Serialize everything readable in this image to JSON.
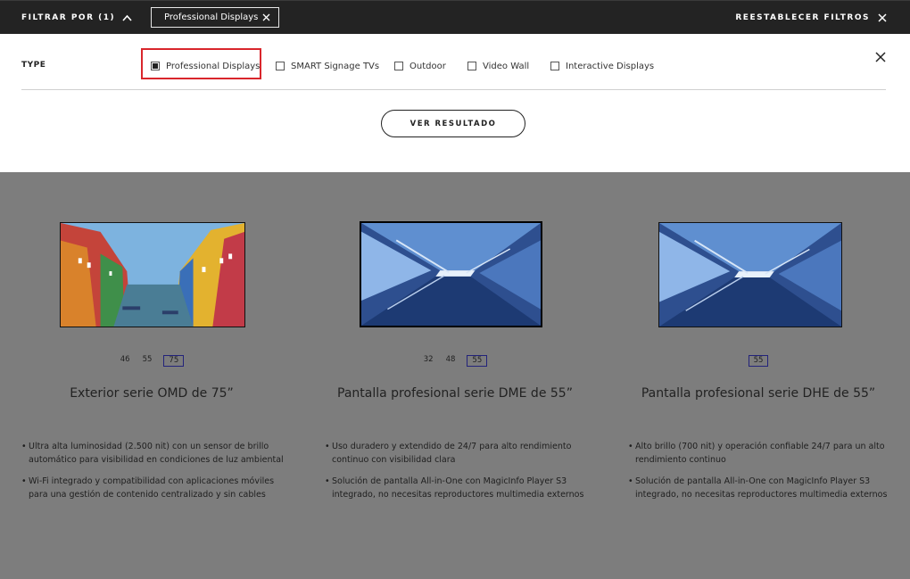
{
  "topbar": {
    "filter_label": "FILTRAR POR (1)",
    "chip_label": "Professional Displays",
    "reset_label": "REESTABLECER FILTROS"
  },
  "filter_panel": {
    "type_label": "TYPE",
    "options": [
      {
        "label": "Professional Displays",
        "checked": true
      },
      {
        "label": "SMART Signage TVs",
        "checked": false
      },
      {
        "label": "Outdoor",
        "checked": false
      },
      {
        "label": "Video Wall",
        "checked": false
      },
      {
        "label": "Interactive Displays",
        "checked": false
      }
    ],
    "button_label": "VER RESULTADO"
  },
  "products": [
    {
      "sizes": [
        "46",
        "55",
        "75"
      ],
      "selected_size": "75",
      "title": "Exterior serie OMD de 75”",
      "bullets": [
        "Ultra alta luminosidad (2.500 nit) con un sensor de brillo automático para visibilidad en condiciones de luz ambiental",
        "Wi-Fi integrado y compatibilidad con aplicaciones móviles para una gestión de contenido centralizado y sin cables"
      ]
    },
    {
      "sizes": [
        "32",
        "48",
        "55"
      ],
      "selected_size": "55",
      "title": "Pantalla profesional serie DME de 55”",
      "bullets": [
        "Uso duradero y extendido de 24/7 para alto rendimiento continuo con visibilidad clara",
        "Solución de pantalla All-in-One con MagicInfo Player S3 integrado, no necesitas reproductores multimedia externos"
      ]
    },
    {
      "sizes": [
        "55"
      ],
      "selected_size": "55",
      "title": "Pantalla profesional serie DHE de 55”",
      "bullets": [
        "Alto brillo (700 nit) y operación confiable 24/7 para un alto rendimiento continuo",
        "Solución de pantalla All-in-One con MagicInfo Player S3 integrado, no necesitas reproductores multimedia externos"
      ]
    }
  ]
}
